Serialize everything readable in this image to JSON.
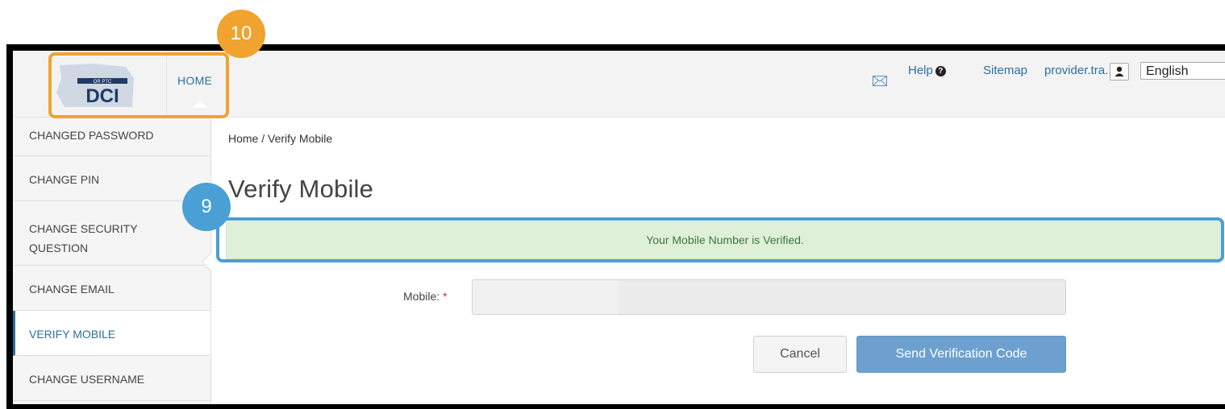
{
  "header": {
    "home_label": "HOME",
    "help_label": "Help",
    "help_icon_glyph": "?",
    "sitemap_label": "Sitemap",
    "user_label": "provider.tra...",
    "language": "English",
    "logo_small_text": "OR PTC",
    "logo_main_text": "DCI"
  },
  "sidebar": {
    "items": [
      {
        "label": "CHANGED PASSWORD"
      },
      {
        "label": "CHANGE PIN"
      },
      {
        "label": "CHANGE SECURITY QUESTION"
      },
      {
        "label": "CHANGE EMAIL"
      },
      {
        "label": "VERIFY MOBILE",
        "active": true
      },
      {
        "label": "CHANGE USERNAME"
      }
    ]
  },
  "main": {
    "breadcrumb": "Home / Verify Mobile",
    "title": "Verify Mobile",
    "success_message": "Your Mobile Number is Verified.",
    "mobile_label": "Mobile:",
    "required_marker": "*",
    "mobile_value": "",
    "cancel_label": "Cancel",
    "send_label": "Send Verification Code"
  },
  "callouts": {
    "orange_number": "10",
    "blue_number": "9"
  },
  "colors": {
    "link": "#2c6f9e",
    "success_bg": "#dff0d8",
    "success_text": "#3c763d",
    "primary_button": "#6da0cf",
    "callout_orange": "#f0a32f",
    "callout_blue": "#4a9fd4"
  }
}
